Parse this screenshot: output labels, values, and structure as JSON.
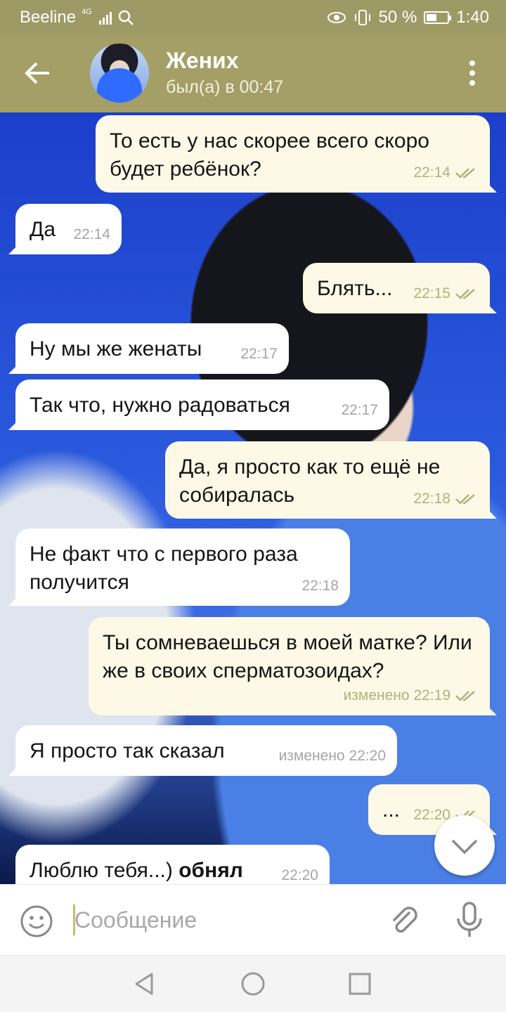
{
  "status": {
    "carrier": "Beeline",
    "network": "4G",
    "battery": "50 %",
    "battery_level": 0.5,
    "time": "1:40"
  },
  "header": {
    "title": "Жених",
    "subtitle": "был(а) в 00:47"
  },
  "colors": {
    "header": "#a39f66",
    "status_bar": "#9e9a66",
    "outgoing_bubble": "#fdf9e6",
    "incoming_bubble": "#ffffff",
    "check": "#b5b07a"
  },
  "messages": [
    {
      "dir": "out",
      "text": "То есть у нас скорее всего скоро будет ребёнок?",
      "time": "22:14",
      "read": true
    },
    {
      "dir": "in",
      "text": "Да",
      "time": "22:14"
    },
    {
      "dir": "out",
      "text": "Блять...",
      "time": "22:15",
      "read": true
    },
    {
      "dir": "in",
      "text": "Ну мы же женаты",
      "time": "22:17"
    },
    {
      "dir": "in",
      "text": "Так что, нужно радоваться",
      "time": "22:17"
    },
    {
      "dir": "out",
      "text": "Да, я просто как то ещё не собиралась",
      "time": "22:18",
      "read": true
    },
    {
      "dir": "in",
      "text": "Не факт что с первого раза получится",
      "time": "22:18"
    },
    {
      "dir": "out",
      "text": "Ты сомневаешься в моей матке? Или же в своих сперматозоидах?",
      "time": "изменено 22:19",
      "read": true
    },
    {
      "dir": "in",
      "text": "Я просто так сказал",
      "time": "изменено 22:20"
    },
    {
      "dir": "out",
      "text": "...",
      "time": "22:20",
      "read": true
    },
    {
      "dir": "in",
      "text": "Люблю тебя...)",
      "text_bold": "обнял",
      "time": "22:20"
    }
  ],
  "input": {
    "placeholder": "Сообщение"
  },
  "icons": {
    "back": "arrow-left-icon",
    "menu": "more-vert-icon",
    "emoji": "emoji-icon",
    "attach": "paperclip-icon",
    "mic": "mic-icon",
    "scroll": "chevron-down-icon",
    "nav_back": "triangle-back-icon",
    "nav_home": "circle-home-icon",
    "nav_recent": "square-recent-icon"
  }
}
